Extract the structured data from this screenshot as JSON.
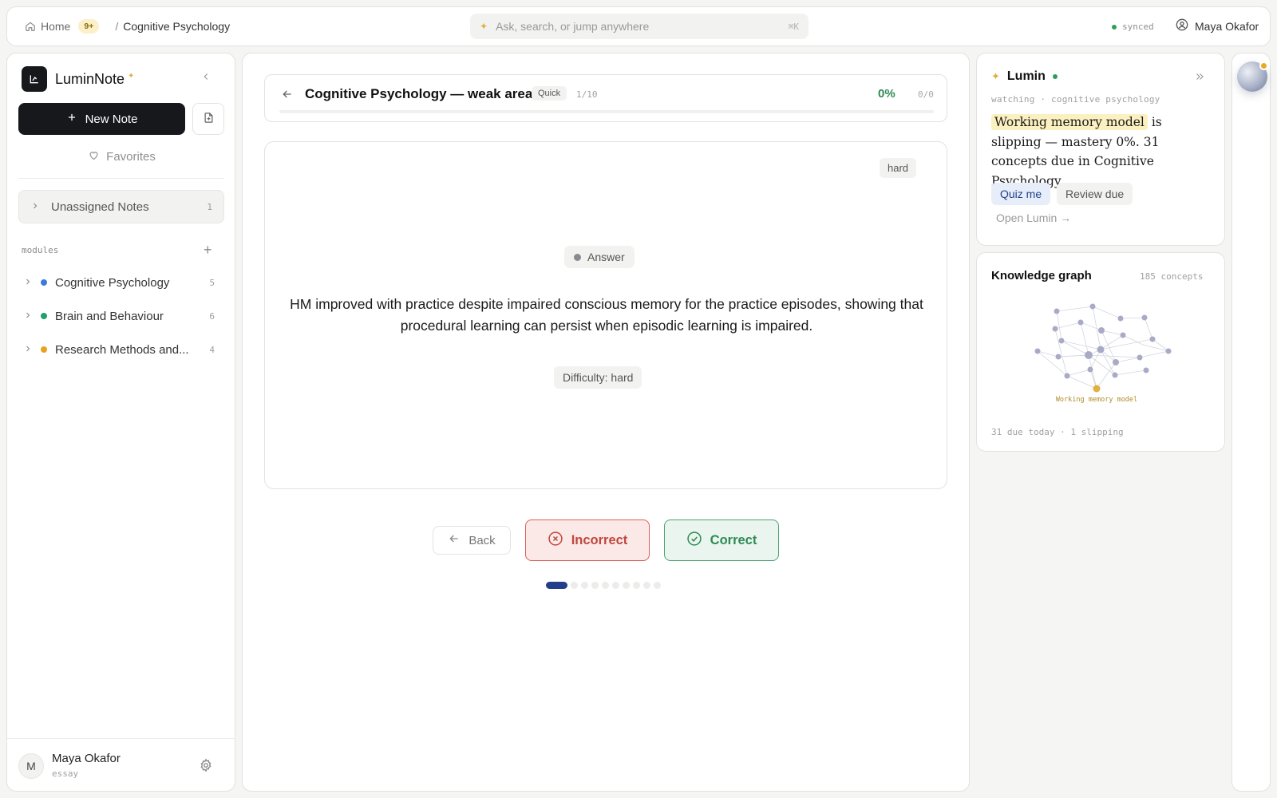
{
  "topbar": {
    "home_label": "Home",
    "notif_count": "9+",
    "separator": "/",
    "current_crumb": "Cognitive Psychology",
    "search_placeholder": "Ask, search, or jump anywhere",
    "search_shortcut": "⌘K",
    "sync_status": "synced",
    "user_name": "Maya Okafor"
  },
  "sidebar": {
    "brand": "LuminNote",
    "new_note_label": "New Note",
    "favorites_label": "Favorites",
    "unassigned": {
      "label": "Unassigned Notes",
      "count": "1"
    },
    "modules_label": "modules",
    "modules": [
      {
        "name": "Cognitive Psychology",
        "count": "5",
        "color": "#3b7be0"
      },
      {
        "name": "Brain and Behaviour",
        "count": "6",
        "color": "#22a06b"
      },
      {
        "name": "Research Methods and...",
        "count": "4",
        "color": "#e8a21f"
      }
    ],
    "footer": {
      "avatar_initial": "M",
      "name": "Maya Okafor",
      "plan": "essay"
    }
  },
  "quiz": {
    "title": "Cognitive Psychology — weak areas",
    "mode_tag": "Quick",
    "index": "1/10",
    "percent": "0%",
    "score": "0/0",
    "progress_fraction": 0,
    "card": {
      "difficulty_tag": "hard",
      "answer_label": "Answer",
      "text": "HM improved with practice despite impaired conscious memory for the practice episodes, showing that procedural learning can persist when episodic learning is impaired.",
      "difficulty_label": "Difficulty: hard"
    },
    "buttons": {
      "back": "Back",
      "incorrect": "Incorrect",
      "correct": "Correct"
    },
    "total_cards": 10,
    "current_card": 1
  },
  "lumin": {
    "title": "Lumin",
    "watching": "watching · cognitive psychology",
    "highlight": "Working memory model",
    "message_rest": " is slipping — mastery 0%. 31 concepts due in Cognitive Psychology.",
    "quiz_me": "Quiz me",
    "review_due": "Review due",
    "open_lumin": "Open Lumin →"
  },
  "graph": {
    "title": "Knowledge graph",
    "count": "185 concepts",
    "focus_label": "Working memory model",
    "footer": "31 due today · 1 slipping"
  },
  "colors": {
    "accent_dark": "#17181b",
    "correct": "#2f8a55",
    "incorrect": "#c0463f",
    "progress_active": "#243f8a",
    "highlight": "#fbf0c0"
  }
}
